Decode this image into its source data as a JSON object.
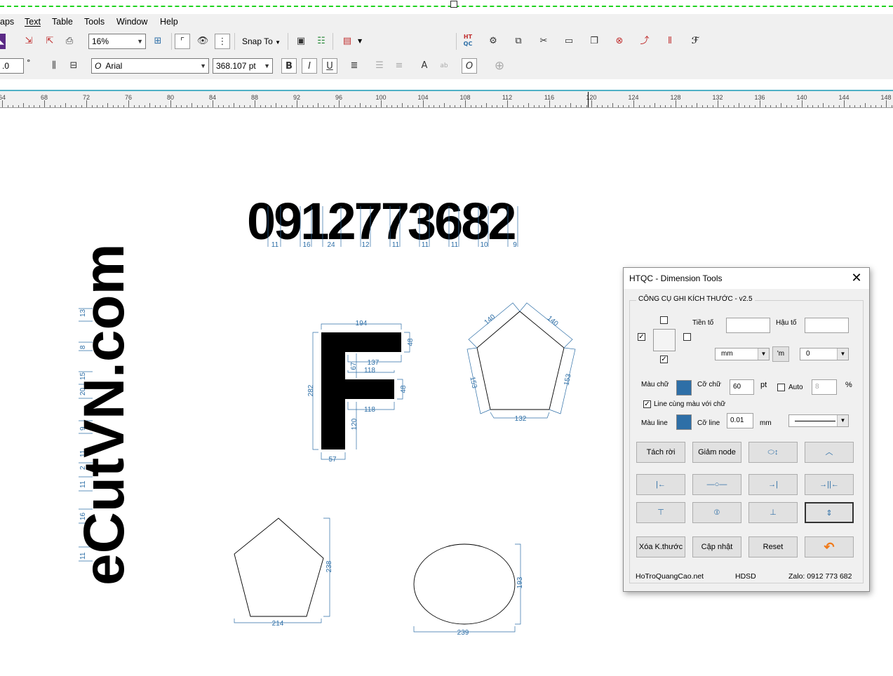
{
  "menu": [
    "aps",
    "Text",
    "Table",
    "Tools",
    "Window",
    "Help"
  ],
  "toolbar1": {
    "zoom": "16%",
    "snap_label": "Snap To"
  },
  "toolbar2": {
    "angle_value": ".0",
    "angle_unit": "°",
    "font_name": "Arial",
    "font_size": "368.107 pt",
    "font_icon": "O"
  },
  "ruler": {
    "labels": [
      "64",
      "68",
      "72",
      "76",
      "80",
      "84",
      "88",
      "92",
      "96",
      "100",
      "104",
      "108",
      "112",
      "116",
      "120",
      "124",
      "128",
      "132",
      "136",
      "140",
      "144",
      "148"
    ]
  },
  "canvas": {
    "phone_text": "0912773682",
    "phone_dims": [
      "11",
      "16",
      "24",
      "12",
      "11",
      "11",
      "11",
      "10",
      "9"
    ],
    "vertical_text": "eCutVN.com",
    "vertical_dims": [
      "13",
      "8",
      "15",
      "20",
      "9",
      "11",
      "2",
      "11",
      "16",
      "11"
    ],
    "letter_f_dims": {
      "top_width": "194",
      "top_bar_height": "48",
      "inner_top": "137",
      "mid_gap": "67",
      "mid_width": "118",
      "mid_height": "48",
      "lower_width": "118",
      "total_height": "282",
      "stem_lower": "120",
      "stem_width": "57"
    },
    "pentagon_dims": {
      "top_left": "140",
      "top_right": "140",
      "left": "153",
      "right": "153",
      "bottom": "132"
    },
    "small_pentagon_dims": {
      "height": "238",
      "width": "214"
    },
    "ellipse_dims": {
      "height": "193",
      "width": "239"
    }
  },
  "dialog": {
    "title": "HTQC - Dimension Tools",
    "group_title": "CÔNG CỤ GHI KÍCH THƯỚC - v2.5",
    "prefix_label": "Tiền tố",
    "suffix_label": "Hậu tố",
    "unit_select": "mm",
    "unit_btn": "'m",
    "decimal_select": "0",
    "text_color_label": "Màu chữ",
    "text_size_label": "Cỡ chữ",
    "text_size_value": "60",
    "text_size_unit": "pt",
    "auto_label": "Auto",
    "auto_value": "8",
    "percent": "%",
    "same_color_label": "Line cùng màu với chữ",
    "line_color_label": "Màu line",
    "line_size_label": "Cỡ line",
    "line_size_value": "0.01",
    "line_size_unit": "mm",
    "buttons_row1": [
      "Tách rời",
      "Giảm node"
    ],
    "buttons_bottom": [
      "Xóa K.thước",
      "Cập nhật",
      "Reset"
    ],
    "footer_site": "HoTroQuangCao.net",
    "footer_help": "HDSD",
    "footer_zalo": "Zalo: 0912 773 682",
    "accent_color": "#2e6fa7"
  }
}
